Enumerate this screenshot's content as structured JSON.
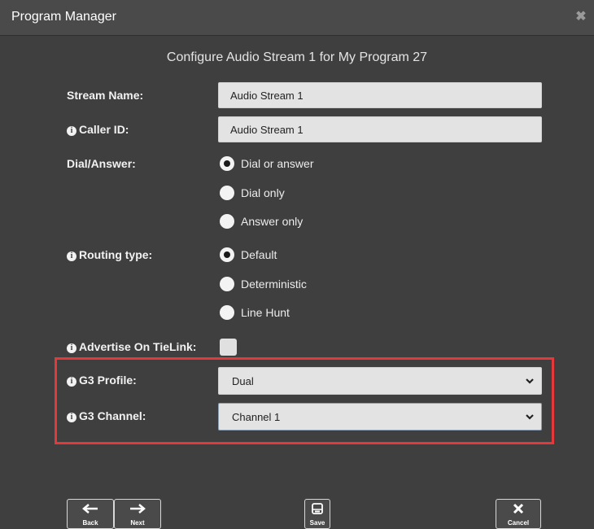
{
  "window": {
    "title": "Program Manager",
    "close_glyph": "✖"
  },
  "heading": "Configure Audio Stream 1 for My Program 27",
  "fields": {
    "stream_name": {
      "label": "Stream Name:",
      "value": "Audio Stream 1"
    },
    "caller_id": {
      "label": "Caller ID:",
      "value": "Audio Stream 1",
      "icon": "info-icon"
    },
    "dial_answer": {
      "label": "Dial/Answer:",
      "options": [
        "Dial or answer",
        "Dial only",
        "Answer only"
      ],
      "selected": "Dial or answer"
    },
    "routing_type": {
      "label": "Routing type:",
      "icon": "info-icon",
      "options": [
        "Default",
        "Deterministic",
        "Line Hunt"
      ],
      "selected": "Default"
    },
    "advertise_tielink": {
      "label": "Advertise On TieLink:",
      "icon": "info-icon",
      "checked": false
    },
    "g3_profile": {
      "label": "G3 Profile:",
      "icon": "info-icon",
      "value": "Dual"
    },
    "g3_channel": {
      "label": "G3 Channel:",
      "icon": "info-icon",
      "value": "Channel 1"
    }
  },
  "highlight_color": "#e5383b",
  "buttons": {
    "back": {
      "label": "Back",
      "icon": "arrow-left-icon"
    },
    "next": {
      "label": "Next",
      "icon": "arrow-right-icon"
    },
    "save": {
      "label": "Save",
      "icon": "save-icon"
    },
    "cancel": {
      "label": "Cancel",
      "icon": "close-icon"
    }
  },
  "colors": {
    "background": "#3f3f3f",
    "titlebar": "#4a4a4a",
    "input": "#e3e3e3"
  }
}
